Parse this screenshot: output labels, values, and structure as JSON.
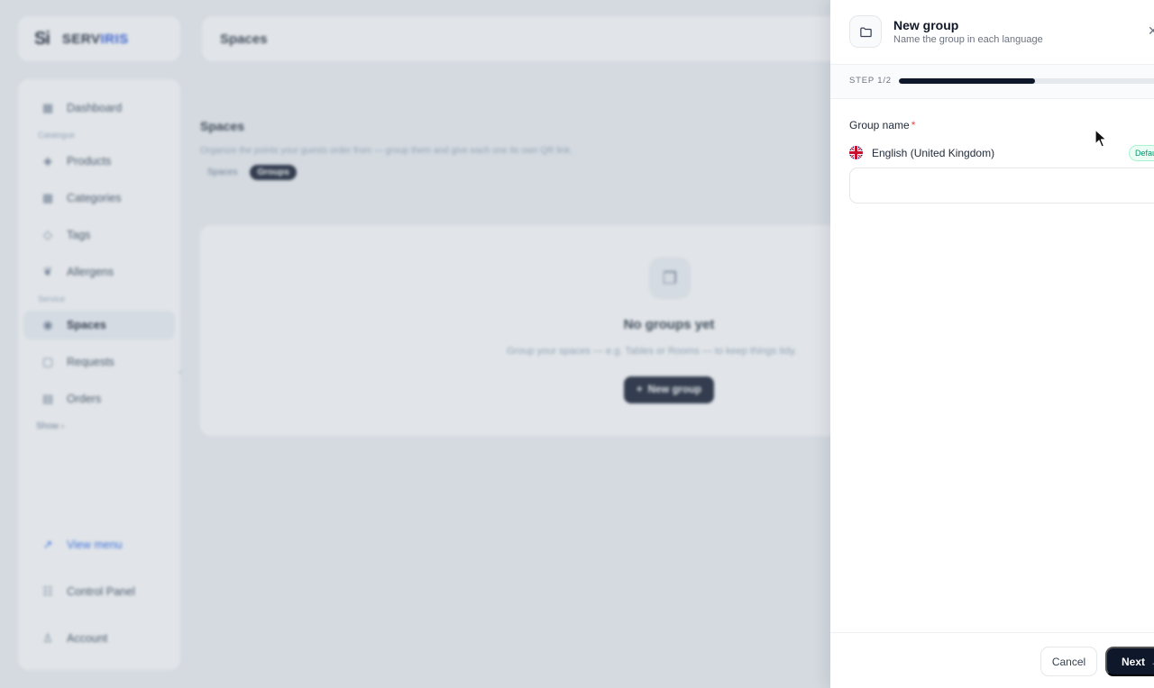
{
  "app": {
    "logo_mark": "Si",
    "logo_text_main": "SERV",
    "logo_text_accent": "IRIS",
    "page_title": "Spaces"
  },
  "sidebar": {
    "items_top": [
      {
        "label": "Dashboard",
        "icon": "grid-icon"
      }
    ],
    "section_catalogue": "Catalogue",
    "items_catalogue": [
      {
        "label": "Products",
        "icon": "box-icon"
      },
      {
        "label": "Categories",
        "icon": "grid-icon"
      },
      {
        "label": "Tags",
        "icon": "tag-icon"
      },
      {
        "label": "Allergens",
        "icon": "leaf-icon"
      }
    ],
    "section_service": "Service",
    "items_service": [
      {
        "label": "Spaces",
        "icon": "location-icon",
        "active": true
      },
      {
        "label": "Requests",
        "icon": "bell-icon"
      },
      {
        "label": "Orders",
        "icon": "receipt-icon"
      }
    ],
    "more_label": "Show",
    "bottom": [
      {
        "label": "View menu",
        "icon": "external-link-icon"
      },
      {
        "label": "Control Panel",
        "icon": "sliders-icon"
      },
      {
        "label": "Account",
        "icon": "user-icon"
      }
    ]
  },
  "content": {
    "title": "Spaces",
    "subtitle": "Organize the points your guests order from — group them and give each one its own QR link.",
    "tabs": [
      "Spaces",
      "Groups"
    ],
    "active_tab": "Groups",
    "empty_title": "No groups yet",
    "empty_text": "Group your spaces — e.g. Tables or Rooms — to keep things tidy.",
    "empty_button": "New group"
  },
  "drawer": {
    "title": "New group",
    "subtitle": "Name the group in each language",
    "step_label": "STEP 1/2",
    "progress": 0.52,
    "field_label": "Group name",
    "required_mark": "*",
    "language": "English (United Kingdom)",
    "default_badge": "Default",
    "input_value": "",
    "input_placeholder": "",
    "cancel_label": "Cancel",
    "next_label": "Next"
  }
}
